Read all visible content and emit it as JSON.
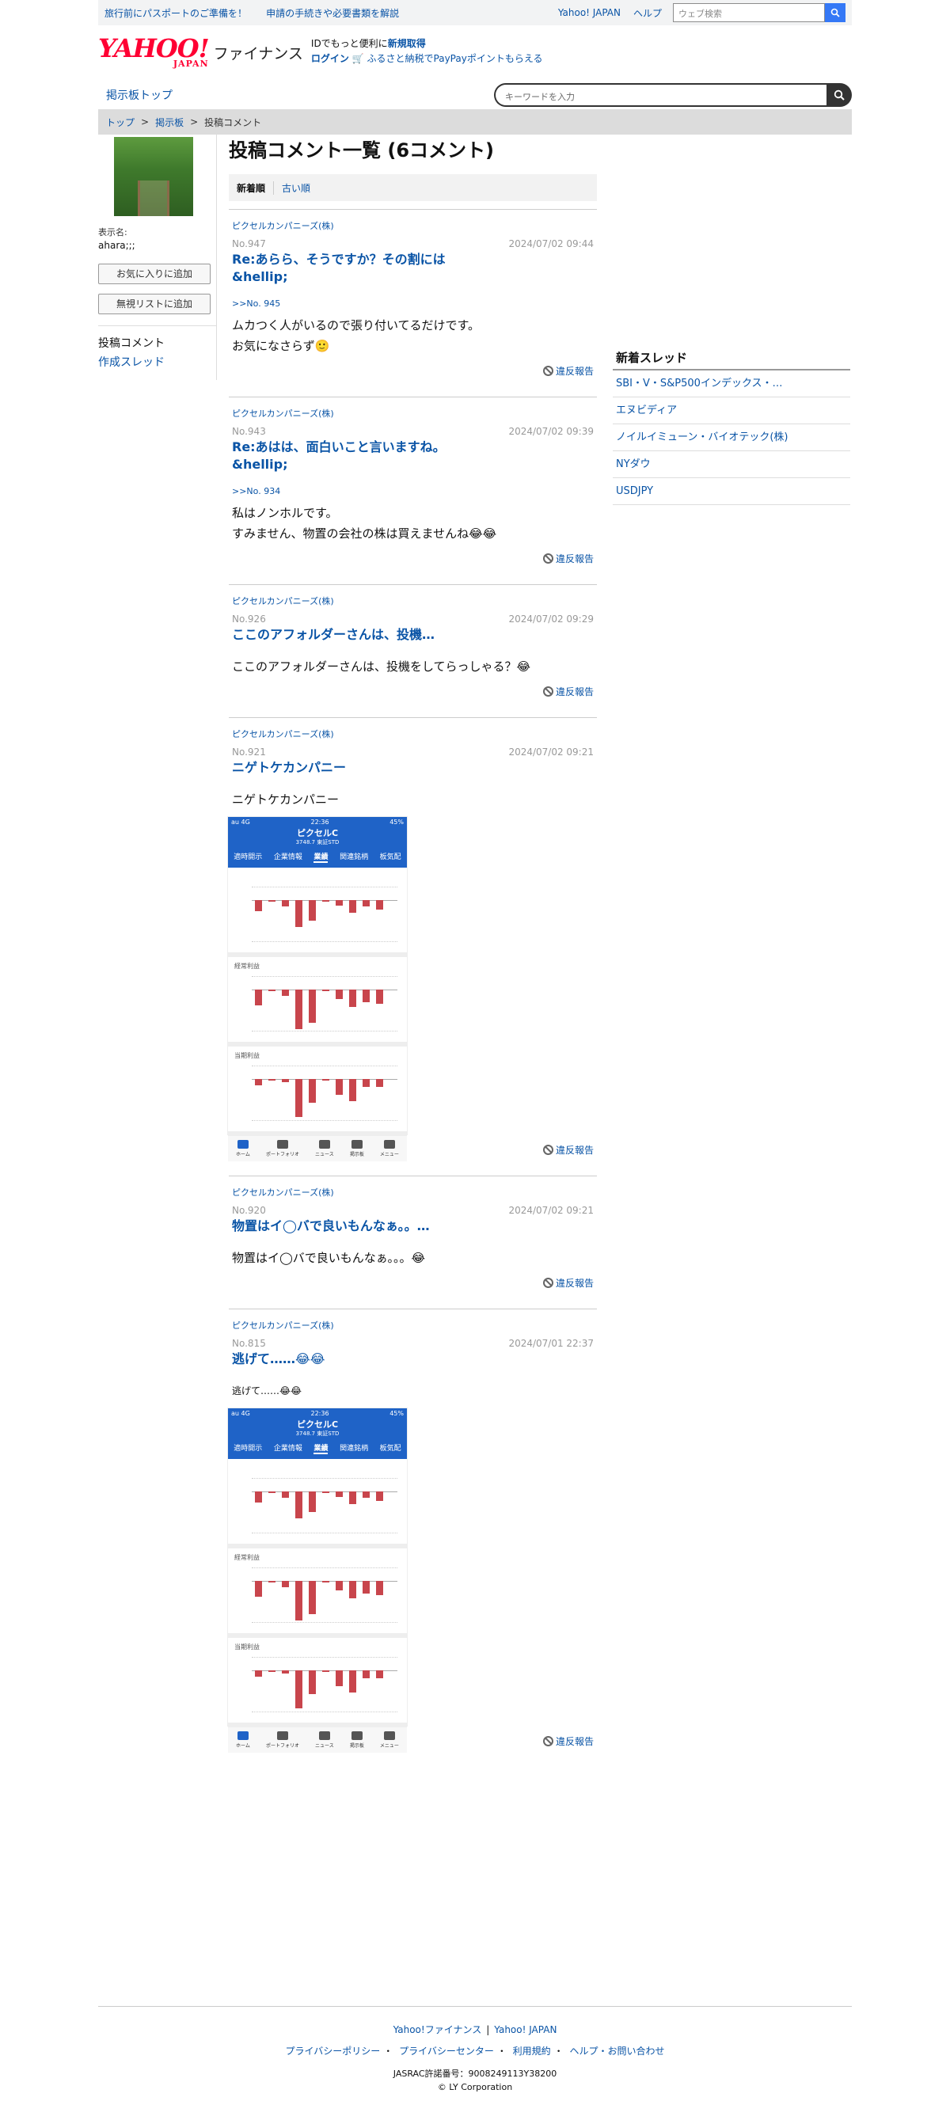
{
  "topbar": {
    "links_left": [
      "旅行前にパスポートのご準備を！",
      "申請の手続きや必要書類を解説"
    ],
    "links_right": [
      "Yahoo! JAPAN",
      "ヘルプ"
    ],
    "web_search_placeholder": "ウェブ検索"
  },
  "header": {
    "logo_text": "YAHOO!",
    "logo_sub": "JAPAN",
    "service_name": "ファイナンス",
    "id_text": "IDでもっと便利に",
    "signup": "新規取得",
    "login": "ログイン",
    "promo": "ふるさと納税でPayPayポイントもらえる"
  },
  "subnav": {
    "board_top": "掲示板トップ",
    "keyword_placeholder": "キーワードを入力"
  },
  "breadcrumb": [
    "トップ",
    "掲示板",
    "投稿コメント"
  ],
  "user": {
    "display_label": "表示名:",
    "name": "ahara;;;",
    "favorite_button": "お気に入りに追加",
    "ignore_button": "無視リストに追加",
    "nav": [
      "投稿コメント",
      "作成スレッド"
    ]
  },
  "main": {
    "title": "投稿コメント一覧 (6コメント)",
    "sort_tabs": [
      "新着順",
      "古い順"
    ],
    "report_label": "違反報告",
    "comments": [
      {
        "company": "ピクセルカンパニーズ(株)",
        "no": "No.947",
        "date": "2024/07/02 09:44",
        "title": "Re:あらら、そうですか？その割には &hellip;",
        "reply": ">>No. 945",
        "body": [
          "ムカつく人がいるので張り付いてるだけです。",
          "お気になさらず🙂"
        ]
      },
      {
        "company": "ピクセルカンパニーズ(株)",
        "no": "No.943",
        "date": "2024/07/02 09:39",
        "title": "Re:あはは、面白いこと言いますね。 &hellip;",
        "reply": ">>No. 934",
        "body": [
          "私はノンホルです。",
          "すみません、物置の会社の株は買えませんね😂😂"
        ]
      },
      {
        "company": "ピクセルカンパニーズ(株)",
        "no": "No.926",
        "date": "2024/07/02 09:29",
        "title": "ここのアフォルダーさんは、投機…",
        "body": [
          "ここのアフォルダーさんは、投機をしてらっしゃる？😂"
        ]
      },
      {
        "company": "ピクセルカンパニーズ(株)",
        "no": "No.921",
        "date": "2024/07/02 09:21",
        "title": "ニゲトケカンパニー",
        "body": [
          "ニゲトケカンパニー"
        ]
      },
      {
        "company": "ピクセルカンパニーズ(株)",
        "no": "No.920",
        "date": "2024/07/02 09:21",
        "title": "物置はイ◯バで良いもんなぁ。。…",
        "body": [
          "物置はイ◯バで良いもんなぁ。。。😂"
        ]
      },
      {
        "company": "ピクセルカンパニーズ(株)",
        "no": "No.815",
        "date": "2024/07/01 22:37",
        "title": "逃げて……😂😂",
        "body": [
          "逃げて……😂😂"
        ]
      }
    ]
  },
  "screenshot": {
    "status_left": "au 4G",
    "time": "22:36",
    "status_right": "45%",
    "company": "ピクセルC",
    "price": "3748.7 東証STD",
    "tabs": [
      "適時開示",
      "企業情報",
      "業績",
      "関連銘柄",
      "板気配"
    ],
    "panels": [
      "",
      "経常利益",
      "当期利益"
    ],
    "footer": [
      "ホーム",
      "ポートフォリオ",
      "ニュース",
      "掲示板",
      "メニュー"
    ]
  },
  "sidebar": {
    "title": "新着スレッド",
    "items": [
      "SBI・V・S&P500インデックス・…",
      "エヌビディア",
      "ノイルイミューン・バイオテック(株)",
      "NYダウ",
      "USDJPY"
    ]
  },
  "footer": {
    "row1": [
      "Yahoo!ファイナンス",
      "Yahoo! JAPAN"
    ],
    "row2": [
      "プライバシーポリシー",
      "プライバシーセンター",
      "利用規約",
      "ヘルプ・お問い合わせ"
    ],
    "jasrac": "JASRAC許諾番号：9008249113Y38200",
    "copyright": "© LY Corporation"
  },
  "colors": {
    "link": "#0a54a6",
    "yahoo_red": "#ff0033",
    "search_blue": "#3478f6",
    "bar_red": "#c8454c",
    "app_blue": "#1f63c7"
  }
}
